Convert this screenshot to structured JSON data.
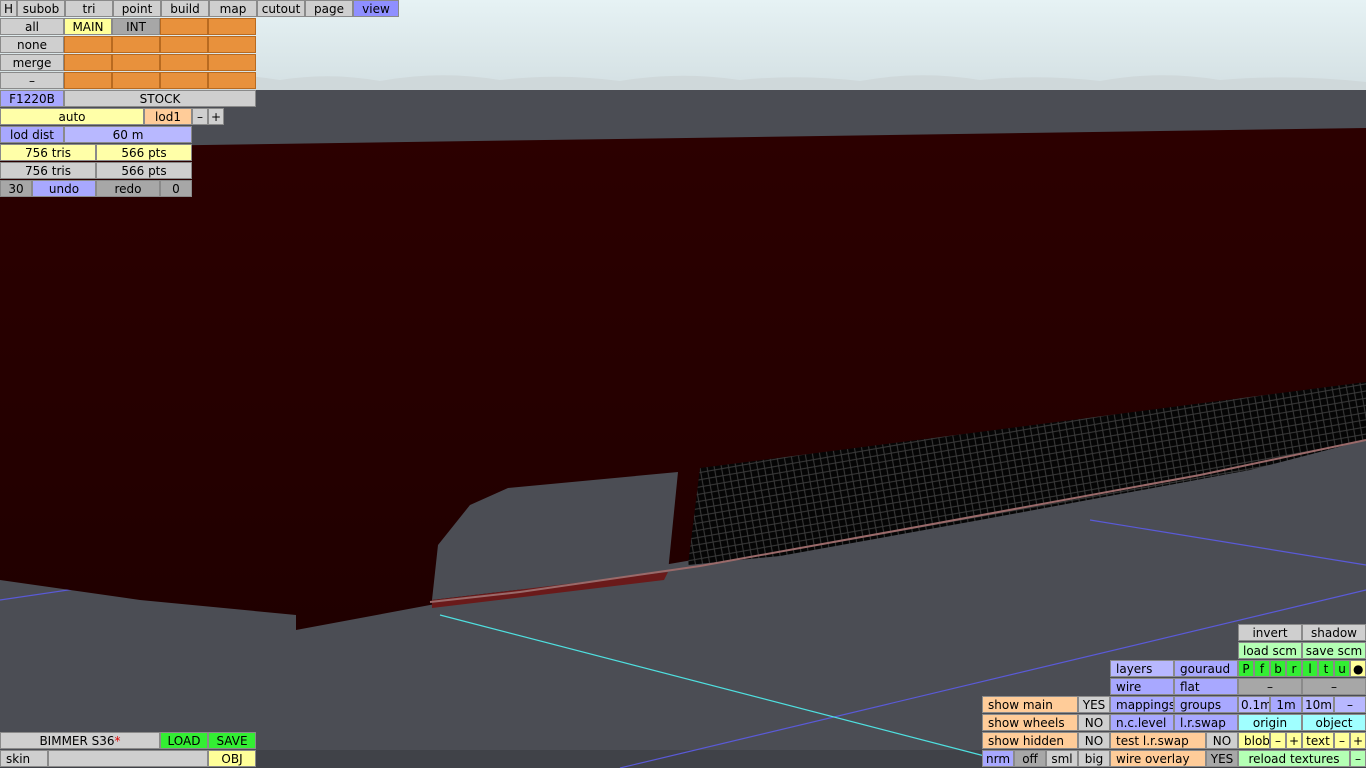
{
  "menu": {
    "h": "H",
    "tabs": [
      "subob",
      "tri",
      "point",
      "build",
      "map",
      "cutout",
      "page",
      "view"
    ]
  },
  "left_panel": {
    "sel_labels": [
      "all",
      "none",
      "merge",
      "–"
    ],
    "main_label": "MAIN",
    "int_label": "INT",
    "object_code": "F1220B",
    "config": "STOCK",
    "lod_mode": "auto",
    "lod_level": "lod1",
    "minus": "–",
    "plus": "+",
    "lod_dist_label": "lod dist",
    "lod_dist_value": "60 m",
    "tris_1": "756 tris",
    "pts_1": "566 pts",
    "tris_2": "756 tris",
    "pts_2": "566 pts",
    "undo_count": "30",
    "undo_label": "undo",
    "redo_label": "redo",
    "redo_count": "0"
  },
  "bottom_left": {
    "car_name": "BIMMER S36",
    "modified_mark": "*",
    "load": "LOAD",
    "save": "SAVE",
    "skin": "skin",
    "obj": "OBJ"
  },
  "bottom_right": {
    "invert": "invert",
    "shadow": "shadow",
    "load_scm": "load scm",
    "save_scm": "save scm",
    "view_letters": [
      "P",
      "f",
      "b",
      "r",
      "l",
      "t",
      "u",
      "●"
    ],
    "layers": "layers",
    "gouraud": "gouraud",
    "wire": "wire",
    "flat": "flat",
    "dash": "–",
    "show_main": "show main",
    "show_main_val": "YES",
    "mappings": "mappings",
    "groups": "groups",
    "grid": [
      "0.1m",
      "1m",
      "10m",
      "–"
    ],
    "show_wheels": "show wheels",
    "show_wheels_val": "NO",
    "nc_level": "n.c.level",
    "lr_swap": "l.r.swap",
    "origin": "origin",
    "object": "object",
    "show_hidden": "show hidden",
    "show_hidden_val": "NO",
    "test_lr_swap": "test l.r.swap",
    "test_lr_swap_val": "NO",
    "blob": "blob",
    "text": "text",
    "minus": "–",
    "plus": "+",
    "sizes": [
      "nrm",
      "off",
      "sml",
      "big"
    ],
    "wire_overlay": "wire overlay",
    "wire_overlay_val": "YES",
    "reload_textures": "reload textures",
    "reload_minus": "–"
  },
  "colors": {
    "sky_top": "#e6f2f4",
    "ground": "#4b4d54",
    "car_body": "#2a0000",
    "accent_view": "#8f8fff"
  }
}
